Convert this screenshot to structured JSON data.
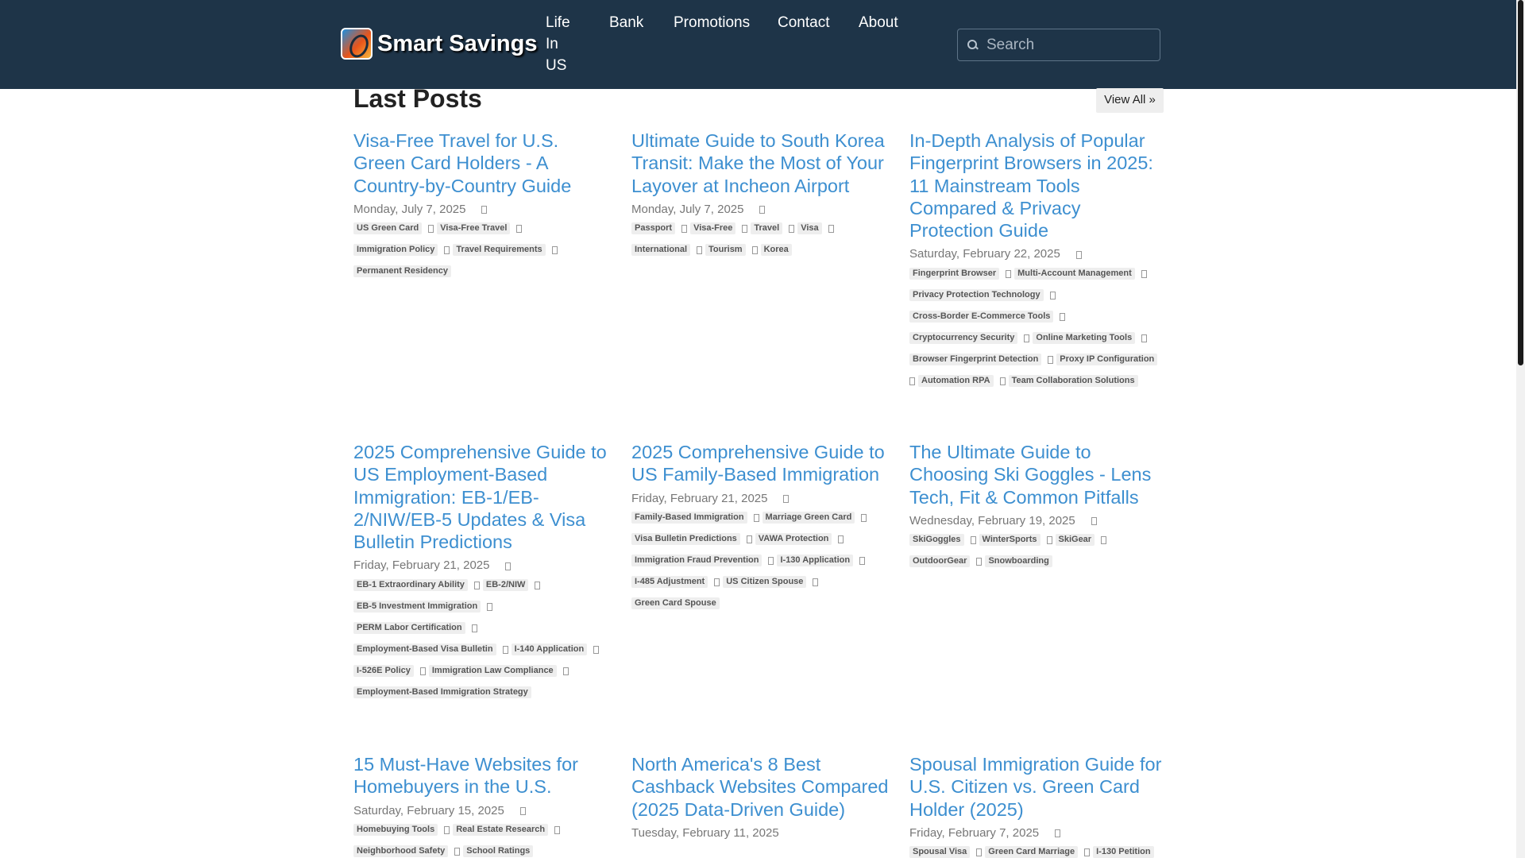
{
  "nav": {
    "brand": "Smart Savings",
    "links": [
      "Life In US",
      "Bank",
      "Promotions",
      "Contact",
      "About"
    ],
    "search_placeholder": "Search"
  },
  "section": {
    "title": "Last Posts",
    "view_all": "View All »"
  },
  "posts": [
    {
      "title": "Visa-Free Travel for U.S. Green Card Holders - A Country-by-Country Guide",
      "date": "Monday, July 7, 2025",
      "tags": [
        "US Green Card",
        "Visa-Free Travel",
        "Immigration Policy",
        "Travel Requirements",
        "Permanent Residency"
      ]
    },
    {
      "title": "Ultimate Guide to South Korea Transit: Make the Most of Your Layover at Incheon Airport",
      "date": "Monday, July 7, 2025",
      "tags": [
        "Passport",
        "Visa-Free",
        "Travel",
        "Visa",
        "International",
        "Tourism",
        "Korea"
      ]
    },
    {
      "title": "In-Depth Analysis of Popular Fingerprint Browsers in 2025: 11 Mainstream Tools Compared & Privacy Protection Guide",
      "date": "Saturday, February 22, 2025",
      "tags": [
        "Fingerprint Browser",
        "Multi-Account Management",
        "Privacy Protection Technology",
        "Cross-Border E-Commerce Tools",
        "Cryptocurrency Security",
        "Online Marketing Tools",
        "Browser Fingerprint Detection",
        "Proxy IP Configuration",
        "Automation RPA",
        "Team Collaboration Solutions"
      ]
    },
    {
      "title": "2025 Comprehensive Guide to US Employment-Based Immigration: EB-1/EB-2/NIW/EB-5 Updates & Visa Bulletin Predictions",
      "date": "Friday, February 21, 2025",
      "tags": [
        "EB-1 Extraordinary Ability",
        "EB-2/NIW",
        "EB-5 Investment Immigration",
        "PERM Labor Certification",
        "Employment-Based Visa Bulletin",
        "I-140 Application",
        "I-526E Policy",
        "Immigration Law Compliance",
        "Employment-Based Immigration Strategy"
      ]
    },
    {
      "title": "2025 Comprehensive Guide to US Family-Based Immigration",
      "date": "Friday, February 21, 2025",
      "tags": [
        "Family-Based Immigration",
        "Marriage Green Card",
        "Visa Bulletin Predictions",
        "VAWA Protection",
        "Immigration Fraud Prevention",
        "I-130 Application",
        "I-485 Adjustment",
        "US Citizen Spouse",
        "Green Card Spouse"
      ]
    },
    {
      "title": "The Ultimate Guide to Choosing Ski Goggles - Lens Tech, Fit & Common Pitfalls",
      "date": "Wednesday, February 19, 2025",
      "tags": [
        "SkiGoggles",
        "WinterSports",
        "SkiGear",
        "OutdoorGear",
        "Snowboarding"
      ]
    },
    {
      "title": "15 Must-Have Websites for Homebuyers in the U.S.",
      "date": "Saturday, February 15, 2025",
      "tags": [
        "Homebuying Tools",
        "Real Estate Research",
        "Neighborhood Safety",
        "School Ratings"
      ]
    },
    {
      "title": "North America's 8 Best Cashback Websites Compared (2025 Data-Driven Guide)",
      "date": "Tuesday, February 11, 2025",
      "tags": []
    },
    {
      "title": "Spousal Immigration Guide for U.S. Citizen vs. Green Card Holder (2025)",
      "date": "Friday, February 7, 2025",
      "tags": [
        "Spousal Visa",
        "Green Card Marriage",
        "I-130 Petition"
      ]
    }
  ]
}
